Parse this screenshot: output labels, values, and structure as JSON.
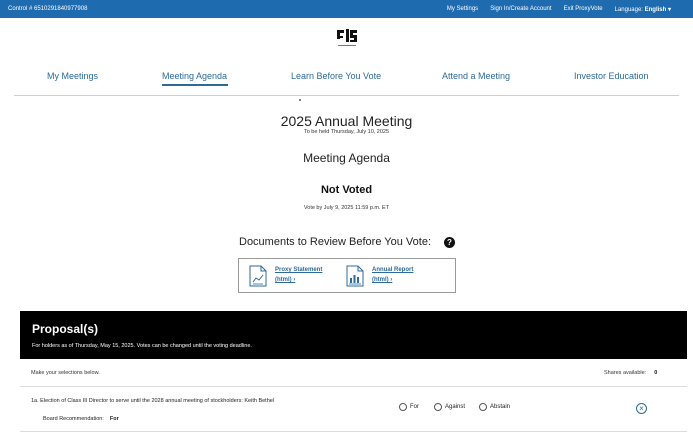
{
  "topbar": {
    "control": "Control # 6510291840977908",
    "my_settings": "My Settings",
    "sign_in": "Sign In/Create Account",
    "exit": "Exit ProxyVote",
    "language_label": "Language:",
    "language_value": "English ▾"
  },
  "nav": {
    "items": [
      "My Meetings",
      "Meeting Agenda",
      "Learn Before You Vote",
      "Attend a Meeting",
      "Investor Education"
    ]
  },
  "meeting": {
    "title": "2025 Annual Meeting",
    "held": "To be held Thursday, July 10, 2025",
    "agenda_title": "Meeting Agenda",
    "status": "Not Voted",
    "deadline": "Vote by July 9, 2025 11:59 p.m. ET"
  },
  "documents": {
    "heading": "Documents to Review Before You Vote:",
    "help": "?",
    "items": [
      {
        "name": "Proxy Statement",
        "format": "(html) ›"
      },
      {
        "name": "Annual Report",
        "format": "(html) ›"
      }
    ]
  },
  "proposals": {
    "title": "Proposal(s)",
    "subtitle": "For holders as of Thursday, May 15, 2025. Votes can be changed until the voting deadline.",
    "instructions": "Make your selections below.",
    "shares_label": "Shares available:",
    "shares_value": "0",
    "items": [
      {
        "number": "1a.",
        "text": "1a.  Election of Class III Director to serve until the 2028 annual meeting of stockholders: Keith Bethel",
        "rec_label": "Board Recommendation:",
        "rec_value": "For",
        "options": [
          "For",
          "Against",
          "Abstain"
        ]
      }
    ]
  },
  "colors": {
    "topbar": "#1f6bb0",
    "link": "#2c6a99",
    "banner": "#000000"
  }
}
